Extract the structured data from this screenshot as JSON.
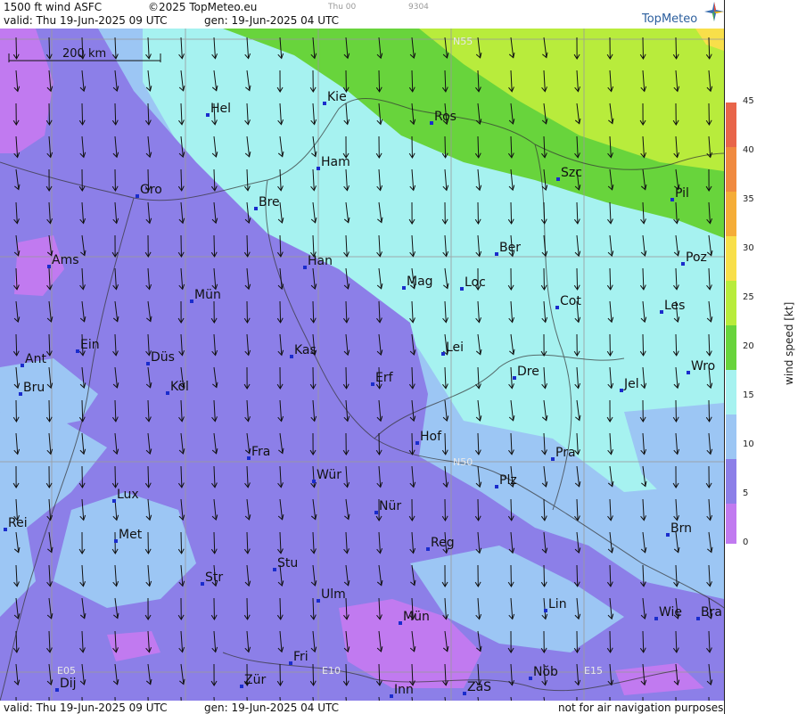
{
  "header": {
    "title": "1500 ft wind ASFC",
    "copyright": "©2025 TopMeteo.eu",
    "valid": "valid:  Thu  19-Jun-2025  09 UTC",
    "gen": "gen: 19-Jun-2025 04 UTC",
    "faint_day": "Thu 00",
    "faint_code": "9304"
  },
  "footer": {
    "valid": "valid:  Thu  19-Jun-2025  09 UTC",
    "gen": "gen: 19-Jun-2025 04 UTC",
    "note": "not for air navigation purposes"
  },
  "logo": {
    "text": "TopMeteo"
  },
  "scale_bar": {
    "label": "200 km"
  },
  "colorbar": {
    "title": "wind speed  [kt]",
    "ticks": [
      "45",
      "40",
      "35",
      "30",
      "25",
      "20",
      "15",
      "10",
      "5",
      "0"
    ],
    "colors": [
      "#e8654a",
      "#f08a40",
      "#f5ad38",
      "#f8df4a",
      "#b8ec3c",
      "#68d43c",
      "#a6f2f0",
      "#9cc6f4",
      "#8c7fe8",
      "#c17af0"
    ]
  },
  "grid_labels": [
    "N55",
    "N50",
    "E05",
    "E10",
    "E15"
  ],
  "cities": [
    {
      "name": "Hel"
    },
    {
      "name": "Kie"
    },
    {
      "name": "Ros"
    },
    {
      "name": "Ham"
    },
    {
      "name": "Szc"
    },
    {
      "name": "Gro"
    },
    {
      "name": "Bre"
    },
    {
      "name": "Pil"
    },
    {
      "name": "Ber"
    },
    {
      "name": "Ams"
    },
    {
      "name": "Han"
    },
    {
      "name": "Poz"
    },
    {
      "name": "Mag"
    },
    {
      "name": "Loc"
    },
    {
      "name": "Mün"
    },
    {
      "name": "Cot"
    },
    {
      "name": "Les"
    },
    {
      "name": "Ein"
    },
    {
      "name": "Kas"
    },
    {
      "name": "Lei"
    },
    {
      "name": "Ant"
    },
    {
      "name": "Düs"
    },
    {
      "name": "Wro"
    },
    {
      "name": "Dre"
    },
    {
      "name": "Erf"
    },
    {
      "name": "Bru"
    },
    {
      "name": "Köl"
    },
    {
      "name": "Jel"
    },
    {
      "name": "Hof"
    },
    {
      "name": "Fra"
    },
    {
      "name": "Pra"
    },
    {
      "name": "Wür"
    },
    {
      "name": "Plz"
    },
    {
      "name": "Lux"
    },
    {
      "name": "Nür"
    },
    {
      "name": "Rei"
    },
    {
      "name": "Met"
    },
    {
      "name": "Brn"
    },
    {
      "name": "Reg"
    },
    {
      "name": "Stu"
    },
    {
      "name": "Str"
    },
    {
      "name": "Ulm"
    },
    {
      "name": "Lin"
    },
    {
      "name": "Mün"
    },
    {
      "name": "Wie"
    },
    {
      "name": "Bra"
    },
    {
      "name": "Fri"
    },
    {
      "name": "Nŏb"
    },
    {
      "name": "Dij"
    },
    {
      "name": "Zür"
    },
    {
      "name": "ZaS"
    },
    {
      "name": "Inn"
    }
  ]
}
